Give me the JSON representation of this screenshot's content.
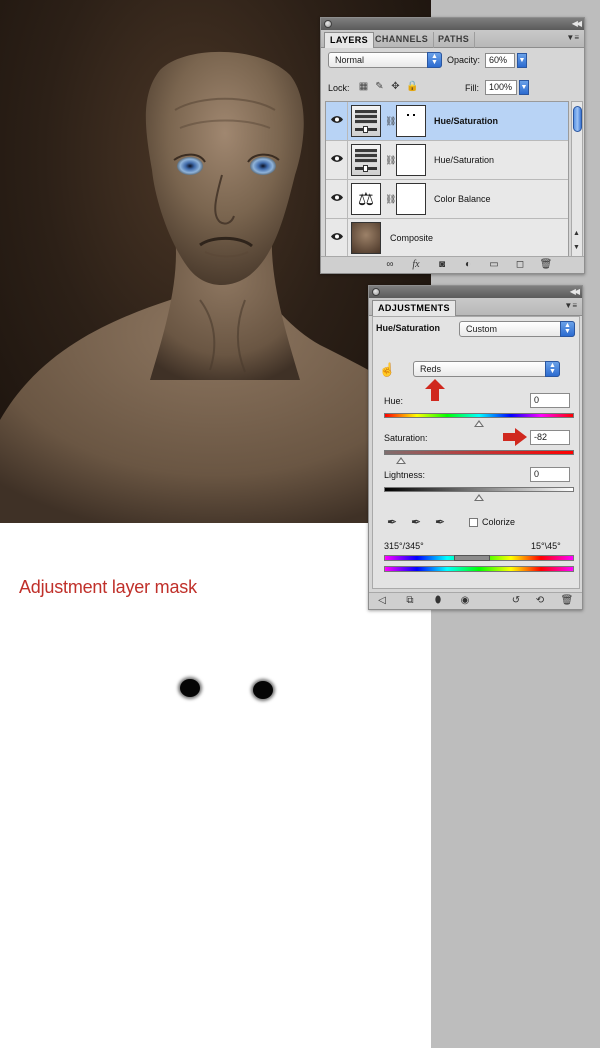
{
  "layers_panel": {
    "tabs": [
      "LAYERS",
      "CHANNELS",
      "PATHS"
    ],
    "blend_mode": "Normal",
    "opacity_label": "Opacity:",
    "opacity_value": "60%",
    "lock_label": "Lock:",
    "fill_label": "Fill:",
    "fill_value": "100%",
    "layers": [
      {
        "name": "Hue/Saturation",
        "selected": true
      },
      {
        "name": "Hue/Saturation",
        "selected": false
      },
      {
        "name": "Color Balance",
        "selected": false
      },
      {
        "name": "Composite",
        "selected": false
      }
    ],
    "bottom_icons": [
      "link-icon",
      "fx-icon",
      "mask-icon",
      "adjustment-icon",
      "folder-icon",
      "new-layer-icon",
      "trash-icon"
    ]
  },
  "adjustments_panel": {
    "tab": "ADJUSTMENTS",
    "title": "Hue/Saturation",
    "preset": "Custom",
    "channel": "Reds",
    "hue_label": "Hue:",
    "hue_value": "0",
    "saturation_label": "Saturation:",
    "saturation_value": "-82",
    "lightness_label": "Lightness:",
    "lightness_value": "0",
    "colorize_label": "Colorize",
    "range_left": "315°/345°",
    "range_right": "15°\\45°",
    "hue_level": 0.5,
    "saturation_level": 0.09,
    "lightness_level": 0.5,
    "accent_color": "#d0281e",
    "bottom_icons": [
      "back-arrow-icon",
      "expand-view-icon",
      "clip-icon",
      "visibility-icon",
      "previous-state-icon",
      "reset-icon",
      "trash-icon"
    ]
  },
  "caption": {
    "text": "Adjustment layer mask",
    "color": "#c0302a"
  }
}
